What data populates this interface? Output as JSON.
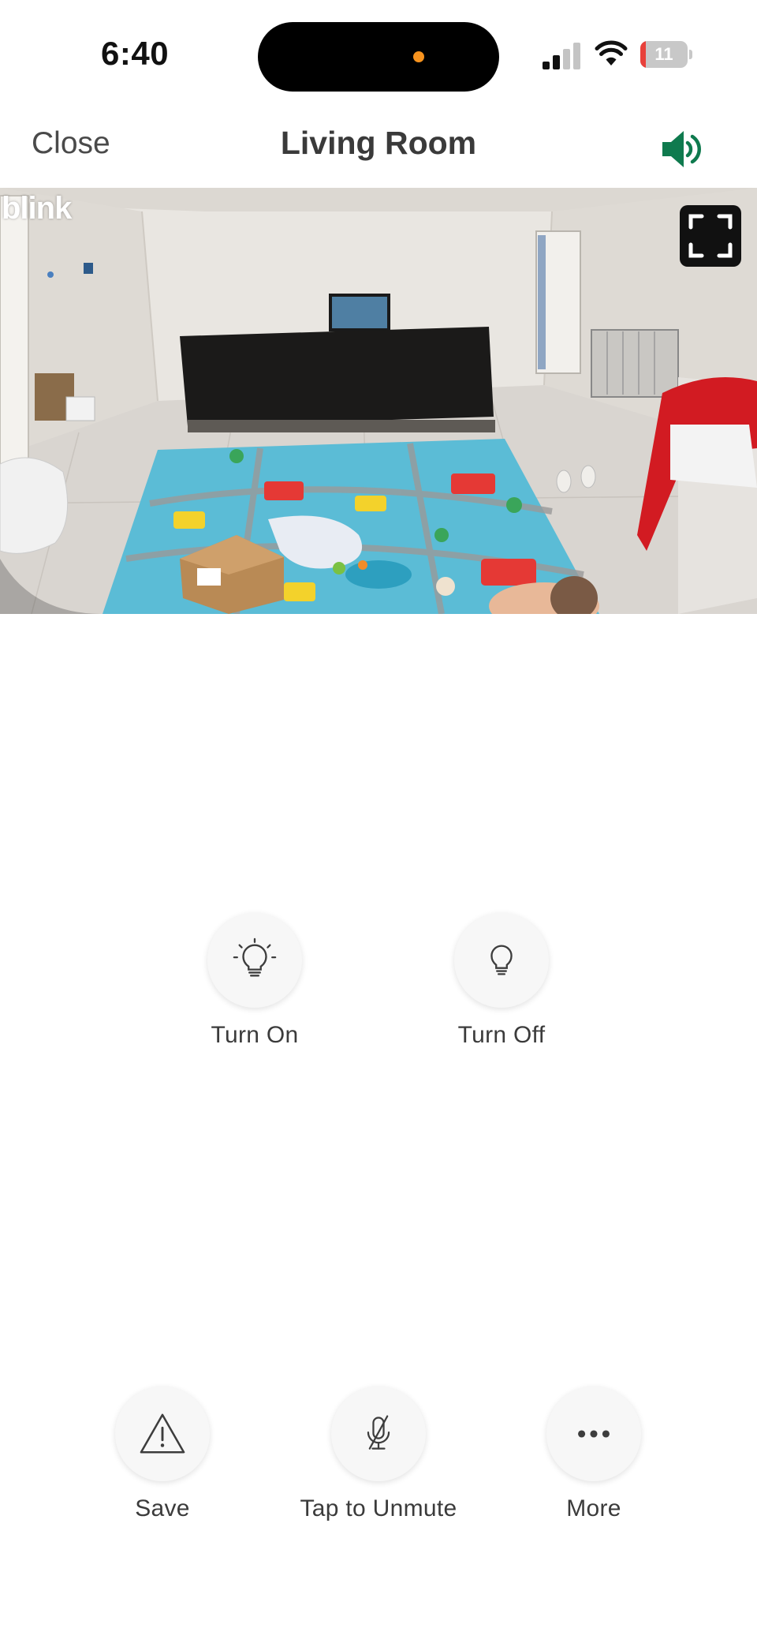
{
  "status_bar": {
    "time": "6:40",
    "battery_level": "11",
    "battery_fraction": 0.11,
    "signal_bars_active": 2,
    "signal_bars_total": 4
  },
  "nav": {
    "close_label": "Close",
    "title": "Living Room",
    "speaker_icon": "speaker-on-icon",
    "speaker_color": "#0f7a4e"
  },
  "video": {
    "watermark": "blink",
    "fullscreen_icon": "fullscreen-icon"
  },
  "light_controls": [
    {
      "label": "Turn On",
      "icon": "bulb-on-icon"
    },
    {
      "label": "Turn Off",
      "icon": "bulb-off-icon"
    }
  ],
  "bottom_actions": [
    {
      "label": "Save",
      "icon": "warning-icon"
    },
    {
      "label": "Tap to Unmute",
      "icon": "mic-muted-icon"
    },
    {
      "label": "More",
      "icon": "more-icon"
    }
  ]
}
